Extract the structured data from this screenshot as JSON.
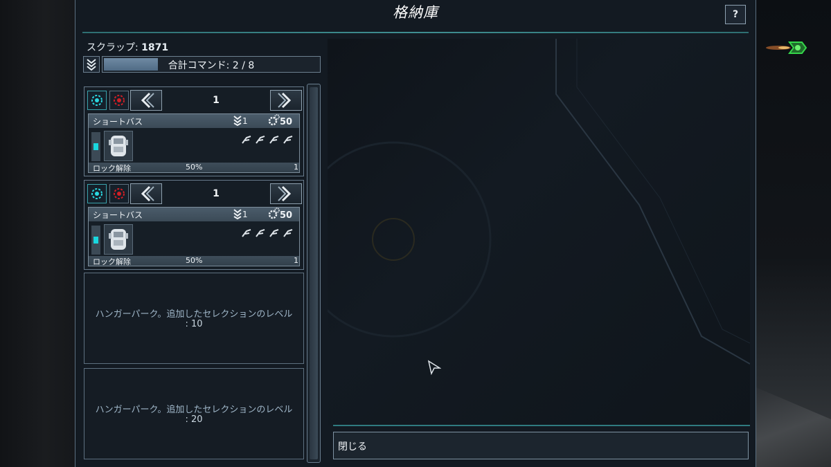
{
  "window": {
    "title": "格納庫",
    "help_label": "?"
  },
  "resources": {
    "scrap_label": "スクラップ: ",
    "scrap_value": "1871",
    "command_text": "合計コマンド: 2 / 8",
    "command_fraction": 0.25
  },
  "units": [
    {
      "page": "1",
      "name": "ショートバス",
      "rank": "1",
      "cost": "50",
      "unlock_label": "ロック解除",
      "unlock_pct": "50%",
      "unlock_count": "1"
    },
    {
      "page": "1",
      "name": "ショートバス",
      "rank": "1",
      "cost": "50",
      "unlock_label": "ロック解除",
      "unlock_pct": "50%",
      "unlock_count": "1"
    }
  ],
  "perks": [
    {
      "text": "ハンガーパーク。追加したセレクションのレベル",
      "value": ": 10"
    },
    {
      "text": "ハンガーパーク。追加したセレクションのレベル",
      "value": ": 20"
    }
  ],
  "footer": {
    "close_label": "閉じる"
  },
  "icons": {
    "help": "question-icon",
    "rank": "chevron-rank-icon",
    "cost": "gear-icon",
    "prev": "chevron-left-icon",
    "next": "chevron-right-icon"
  },
  "colors": {
    "accent_teal": "#3f8f92",
    "led_cyan": "#19d7df",
    "red_selector": "#d11f25"
  }
}
